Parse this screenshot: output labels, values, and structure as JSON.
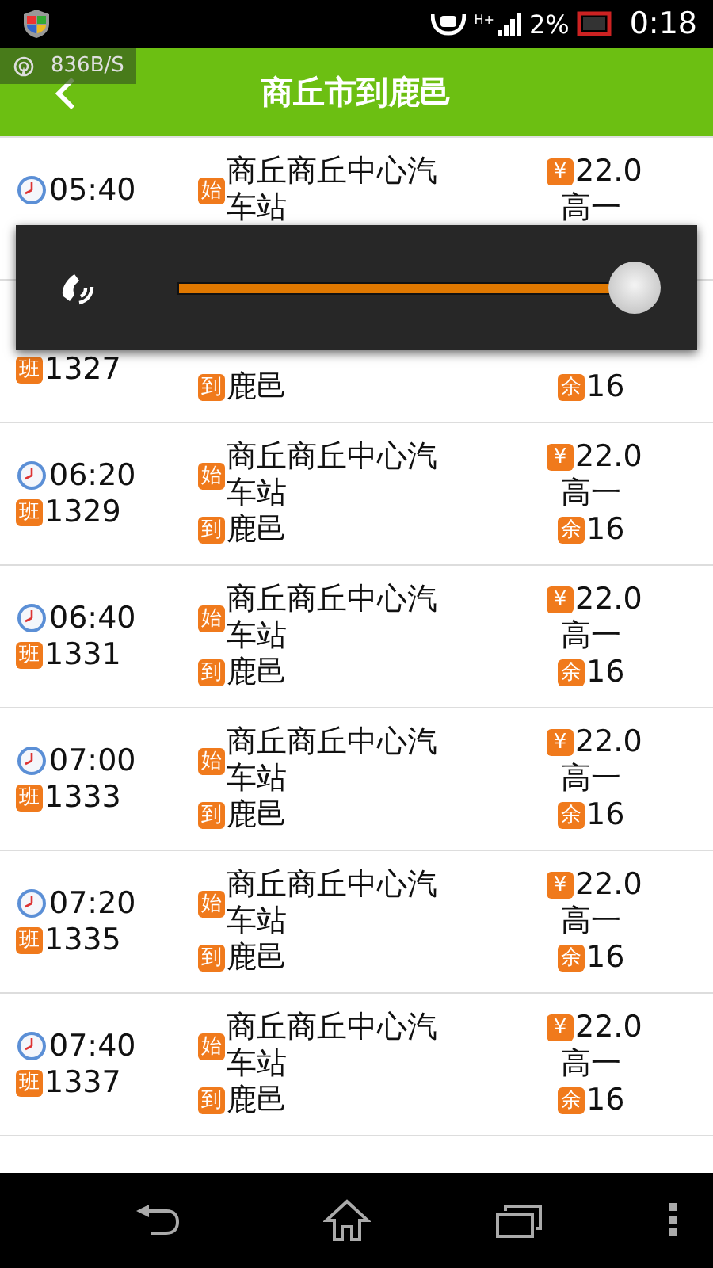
{
  "status_bar": {
    "network": "H+",
    "battery": "2%",
    "time": "0:18"
  },
  "net_speed": "836B/S",
  "header": {
    "title": "商丘市到鹿邑"
  },
  "rows": [
    {
      "time": "05:40",
      "start_tag": "始",
      "start_lines": [
        "商丘商丘中心汽",
        "车站"
      ],
      "price_tag": "¥",
      "price": "22.0",
      "class": "高一"
    },
    {
      "number_tag": "班",
      "number": "1327",
      "end_tag": "到",
      "end": "鹿邑",
      "seats_tag": "余",
      "seats": "16"
    },
    {
      "time": "06:20",
      "number_tag": "班",
      "number": "1329",
      "start_tag": "始",
      "start_lines": [
        "商丘商丘中心汽",
        "车站"
      ],
      "end_tag": "到",
      "end": "鹿邑",
      "price_tag": "¥",
      "price": "22.0",
      "class": "高一",
      "seats_tag": "余",
      "seats": "16"
    },
    {
      "time": "06:40",
      "number_tag": "班",
      "number": "1331",
      "start_tag": "始",
      "start_lines": [
        "商丘商丘中心汽",
        "车站"
      ],
      "end_tag": "到",
      "end": "鹿邑",
      "price_tag": "¥",
      "price": "22.0",
      "class": "高一",
      "seats_tag": "余",
      "seats": "16"
    },
    {
      "time": "07:00",
      "number_tag": "班",
      "number": "1333",
      "start_tag": "始",
      "start_lines": [
        "商丘商丘中心汽",
        "车站"
      ],
      "end_tag": "到",
      "end": "鹿邑",
      "price_tag": "¥",
      "price": "22.0",
      "class": "高一",
      "seats_tag": "余",
      "seats": "16"
    },
    {
      "time": "07:20",
      "number_tag": "班",
      "number": "1335",
      "start_tag": "始",
      "start_lines": [
        "商丘商丘中心汽",
        "车站"
      ],
      "end_tag": "到",
      "end": "鹿邑",
      "price_tag": "¥",
      "price": "22.0",
      "class": "高一",
      "seats_tag": "余",
      "seats": "16"
    },
    {
      "time": "07:40",
      "number_tag": "班",
      "number": "1337",
      "start_tag": "始",
      "start_lines": [
        "商丘商丘中心汽",
        "车站"
      ],
      "end_tag": "到",
      "end": "鹿邑",
      "price_tag": "¥",
      "price": "22.0",
      "class": "高一",
      "seats_tag": "余",
      "seats": "16"
    }
  ],
  "volume": {
    "level": 1.0
  }
}
